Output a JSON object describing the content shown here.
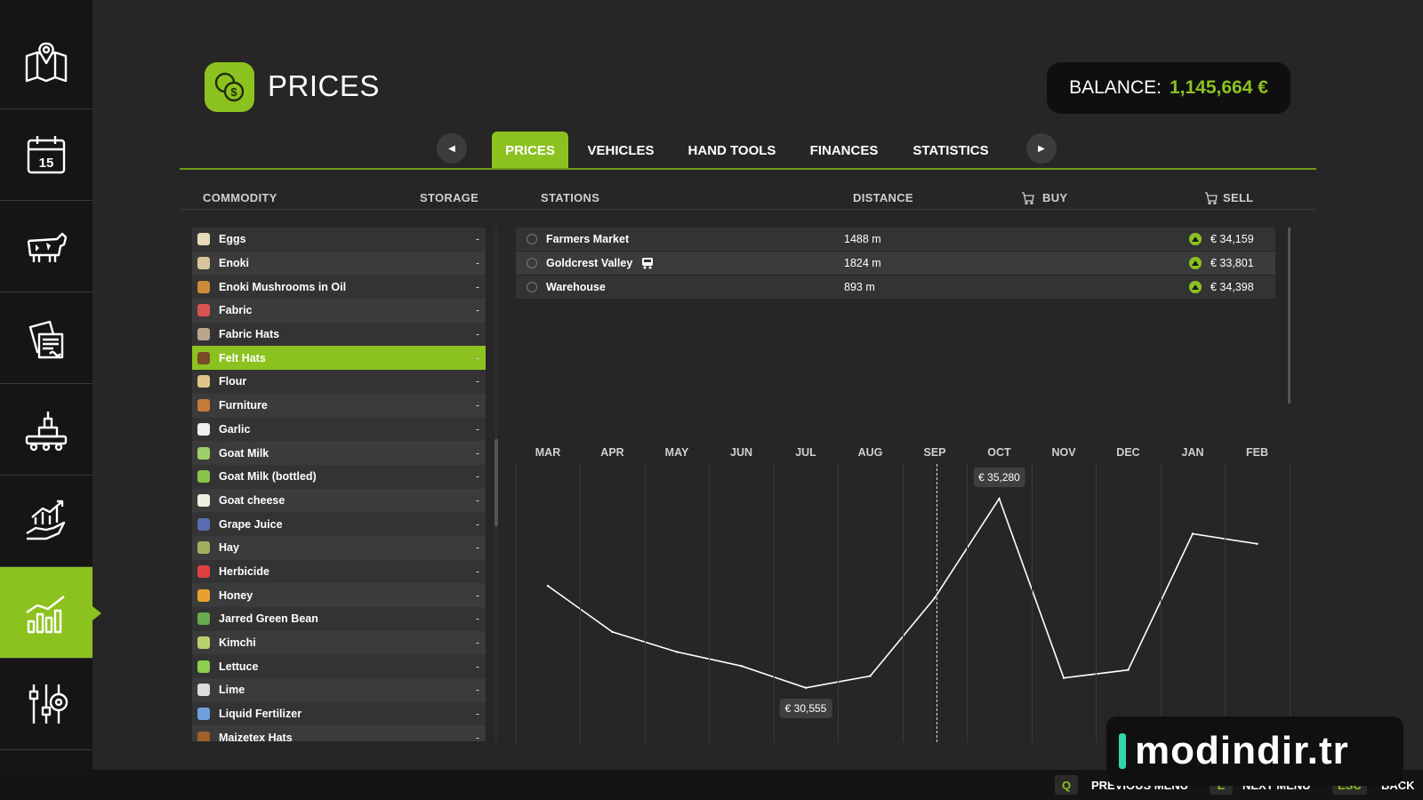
{
  "header": {
    "title": "PRICES",
    "balance_label": "BALANCE:",
    "balance_value": "1,145,664 €"
  },
  "tabs": [
    {
      "label": "PRICES",
      "active": true
    },
    {
      "label": "VEHICLES",
      "active": false
    },
    {
      "label": "HAND TOOLS",
      "active": false
    },
    {
      "label": "FINANCES",
      "active": false
    },
    {
      "label": "STATISTICS",
      "active": false
    }
  ],
  "columns": {
    "commodity": "COMMODITY",
    "storage": "STORAGE",
    "stations": "STATIONS",
    "distance": "DISTANCE",
    "buy": "BUY",
    "sell": "SELL"
  },
  "commodities": [
    {
      "name": "Eggs",
      "storage": "-",
      "color": "#e8d9b8"
    },
    {
      "name": "Enoki",
      "storage": "-",
      "color": "#d8c49a"
    },
    {
      "name": "Enoki Mushrooms in Oil",
      "storage": "-",
      "color": "#c98a3a"
    },
    {
      "name": "Fabric",
      "storage": "-",
      "color": "#d9534f"
    },
    {
      "name": "Fabric Hats",
      "storage": "-",
      "color": "#b9a58a"
    },
    {
      "name": "Felt Hats",
      "storage": "-",
      "color": "#7a4a24",
      "selected": true
    },
    {
      "name": "Flour",
      "storage": "-",
      "color": "#e0c28a"
    },
    {
      "name": "Furniture",
      "storage": "-",
      "color": "#c47a3a"
    },
    {
      "name": "Garlic",
      "storage": "-",
      "color": "#eeeeee"
    },
    {
      "name": "Goat Milk",
      "storage": "-",
      "color": "#9ccf6a"
    },
    {
      "name": "Goat Milk (bottled)",
      "storage": "-",
      "color": "#8bc34a"
    },
    {
      "name": "Goat cheese",
      "storage": "-",
      "color": "#f0f0e0"
    },
    {
      "name": "Grape Juice",
      "storage": "-",
      "color": "#5a6db0"
    },
    {
      "name": "Hay",
      "storage": "-",
      "color": "#a0b060"
    },
    {
      "name": "Herbicide",
      "storage": "-",
      "color": "#e04040"
    },
    {
      "name": "Honey",
      "storage": "-",
      "color": "#e8a030"
    },
    {
      "name": "Jarred Green Bean",
      "storage": "-",
      "color": "#6aaa50"
    },
    {
      "name": "Kimchi",
      "storage": "-",
      "color": "#b8d070"
    },
    {
      "name": "Lettuce",
      "storage": "-",
      "color": "#8ccf50"
    },
    {
      "name": "Lime",
      "storage": "-",
      "color": "#dcdcdc"
    },
    {
      "name": "Liquid Fertilizer",
      "storage": "-",
      "color": "#70a0e0"
    },
    {
      "name": "Maizetex Hats",
      "storage": "-",
      "color": "#a0602a"
    }
  ],
  "stations": [
    {
      "name": "Farmers Market",
      "distance": "1488 m",
      "sell": "€ 34,159",
      "train": false
    },
    {
      "name": "Goldcrest Valley",
      "distance": "1824 m",
      "sell": "€ 33,801",
      "train": true
    },
    {
      "name": "Warehouse",
      "distance": "893 m",
      "sell": "€ 34,398",
      "train": false
    }
  ],
  "chart_data": {
    "type": "line",
    "categories": [
      "MAR",
      "APR",
      "MAY",
      "JUN",
      "JUL",
      "AUG",
      "SEP",
      "OCT",
      "NOV",
      "DEC",
      "JAN",
      "FEB"
    ],
    "series": [
      {
        "values": [
          33100,
          31950,
          31450,
          31100,
          30555,
          30850,
          32800,
          35280,
          30800,
          31000,
          34400,
          34150
        ]
      }
    ],
    "ylim": [
      30150,
      35300
    ],
    "current_month": "SEP",
    "annotations": [
      {
        "category": "OCT",
        "label": "€ 35,280"
      },
      {
        "category": "JUL",
        "label": "€ 30,555"
      }
    ],
    "line_color": "#ffffff"
  },
  "footer": {
    "prev_key": "Q",
    "prev_label": "PREVIOUS MENU",
    "next_key": "E",
    "next_label": "NEXT MENU",
    "back_key": "ESC",
    "back_label": "BACK"
  },
  "watermark": "modindir.tr",
  "colors": {
    "accent": "#8cc21f",
    "background": "#262626",
    "sidebar": "#151515"
  },
  "sidebar_icons": [
    "map-icon",
    "calendar-icon",
    "cow-icon",
    "contracts-icon",
    "production-icon",
    "finance-hand-icon",
    "prices-chart-icon",
    "settings-icon"
  ]
}
